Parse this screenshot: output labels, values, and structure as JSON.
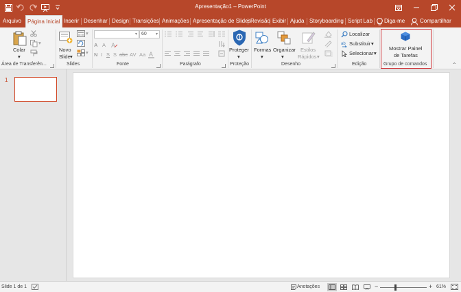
{
  "app": {
    "window_title": "Apresentação1 – PowerPoint",
    "accent": "#b7472a",
    "highlight_color": "#d13438"
  },
  "quick_access": [
    {
      "icon": "save-icon"
    },
    {
      "icon": "undo-icon"
    },
    {
      "icon": "redo-icon"
    },
    {
      "icon": "start-slideshow-icon"
    },
    {
      "icon": "customize-toolbar-icon"
    }
  ],
  "tabs": [
    {
      "label": "Arquivo"
    },
    {
      "label": "Página Inicial",
      "active": true
    },
    {
      "label": "Inserir"
    },
    {
      "label": "Desenhar"
    },
    {
      "label": "Design"
    },
    {
      "label": "Transições"
    },
    {
      "label": "Animações"
    },
    {
      "label": "Apresentação de Slides"
    },
    {
      "label": "Revisão"
    },
    {
      "label": "Exibir"
    },
    {
      "label": "Ajuda"
    },
    {
      "label": "Storyboarding"
    },
    {
      "label": "Script Lab"
    }
  ],
  "tell_me": "Diga-me",
  "share": "Compartilhar",
  "ribbon": {
    "clipboard": {
      "paste_label": "Colar",
      "group_label": "Área de Transferên..."
    },
    "slides": {
      "new_slide_line1": "Novo",
      "new_slide_line2": "Slide",
      "group_label": "Slides"
    },
    "font": {
      "font_name": "",
      "font_size": "60",
      "group_label": "Fonte"
    },
    "paragraph": {
      "group_label": "Parágrafo"
    },
    "protection": {
      "protect_label": "Proteger",
      "group_label": "Proteção"
    },
    "drawing": {
      "shapes_label": "Formas",
      "arrange_label": "Organizar",
      "quick_styles_line1": "Estilos",
      "quick_styles_line2": "Rápidos",
      "group_label": "Desenho"
    },
    "editing": {
      "find_label": "Localizar",
      "replace_label": "Substituir",
      "select_label": "Selecionar",
      "group_label": "Edição"
    },
    "commands": {
      "show_taskpane_line1": "Mostrar Painel",
      "show_taskpane_line2": "de Tarefas",
      "group_label": "Grupo de comandos"
    }
  },
  "slides_pane": {
    "slide_number": "1"
  },
  "status": {
    "slide_info": "Slide 1 de 1",
    "notes_label": "Anotações",
    "zoom": "61%",
    "zoom_minus": "−",
    "zoom_plus": "+"
  }
}
